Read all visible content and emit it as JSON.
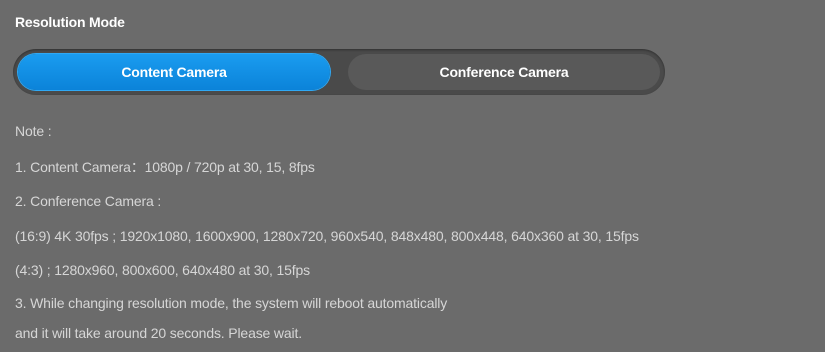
{
  "section": {
    "title": "Resolution Mode"
  },
  "mode_toggle": {
    "options": [
      {
        "label": "Content Camera",
        "selected": true
      },
      {
        "label": "Conference Camera",
        "selected": false
      }
    ],
    "colors": {
      "selected": "#1a9cf0",
      "unselected": "#595959",
      "track": "#4a4a4a"
    }
  },
  "notes": {
    "header": "Note :",
    "lines": [
      "1. Content Camera：1080p / 720p at 30, 15, 8fps",
      "2. Conference Camera :",
      "(16:9) 4K 30fps ; 1920x1080, 1600x900, 1280x720, 960x540, 848x480, 800x448, 640x360 at 30, 15fps",
      "(4:3) ; 1280x960, 800x600, 640x480 at 30, 15fps",
      "3. While changing resolution mode, the system will reboot automatically",
      "and it will take around 20 seconds. Please wait."
    ]
  }
}
